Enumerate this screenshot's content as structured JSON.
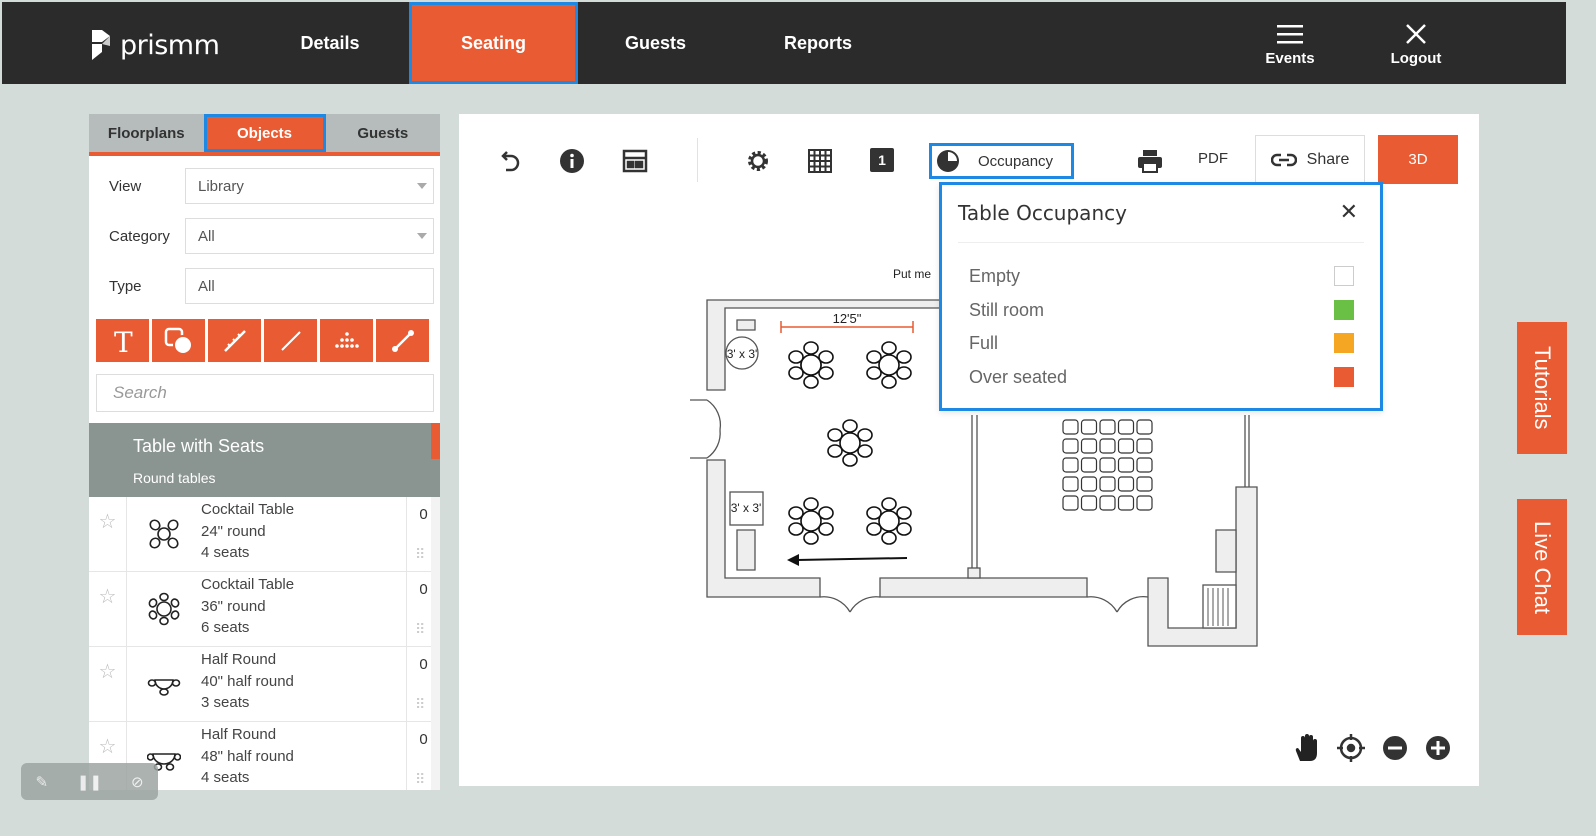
{
  "app": {
    "logo_text": "prismm"
  },
  "nav": {
    "items": [
      {
        "label": "Details"
      },
      {
        "label": "Seating"
      },
      {
        "label": "Guests"
      },
      {
        "label": "Reports"
      }
    ],
    "events_label": "Events",
    "logout_label": "Logout"
  },
  "left_panel": {
    "tabs": [
      {
        "label": "Floorplans"
      },
      {
        "label": "Objects"
      },
      {
        "label": "Guests"
      }
    ],
    "filters": {
      "view_label": "View",
      "view_value": "Library",
      "category_label": "Category",
      "category_value": "All",
      "type_label": "Type",
      "type_value": "All"
    },
    "tools": [
      "text-icon",
      "shape-icon",
      "measure-icon",
      "line-icon",
      "seating-rows-icon",
      "wall-icon"
    ],
    "search_placeholder": "Search",
    "section": {
      "title": "Table with Seats",
      "subtitle": "Round tables"
    },
    "items": [
      {
        "name": "Cocktail Table",
        "size": "24\" round",
        "seats": "4 seats",
        "count": "0"
      },
      {
        "name": "Cocktail Table",
        "size": "36\" round",
        "seats": "6 seats",
        "count": "0"
      },
      {
        "name": "Half Round",
        "size": "40\" half round",
        "seats": "3 seats",
        "count": "0"
      },
      {
        "name": "Half Round",
        "size": "48\" half round",
        "seats": "4 seats",
        "count": "0"
      }
    ]
  },
  "toolbar": {
    "occupancy_label": "Occupancy",
    "pdf_label": "PDF",
    "share_label": "Share",
    "btn3d_label": "3D",
    "grid_number": "1"
  },
  "occupancy_popup": {
    "title": "Table Occupancy",
    "legend": [
      {
        "label": "Empty",
        "color": "#ffffff"
      },
      {
        "label": "Still room",
        "color": "#6abf45"
      },
      {
        "label": "Full",
        "color": "#f5a623"
      },
      {
        "label": "Over seated",
        "color": "#e95b32"
      }
    ]
  },
  "floorplan": {
    "dimension_label": "12'5\"",
    "box_label_1": "3' x 3'",
    "box_label_2": "3' x 3'",
    "put_me_text": "Put me"
  },
  "side_tabs": {
    "tutorials": "Tutorials",
    "live_chat": "Live Chat"
  },
  "colors": {
    "accent": "#e95b32",
    "topbar": "#2b2b2b",
    "highlight": "#1e88e5"
  }
}
